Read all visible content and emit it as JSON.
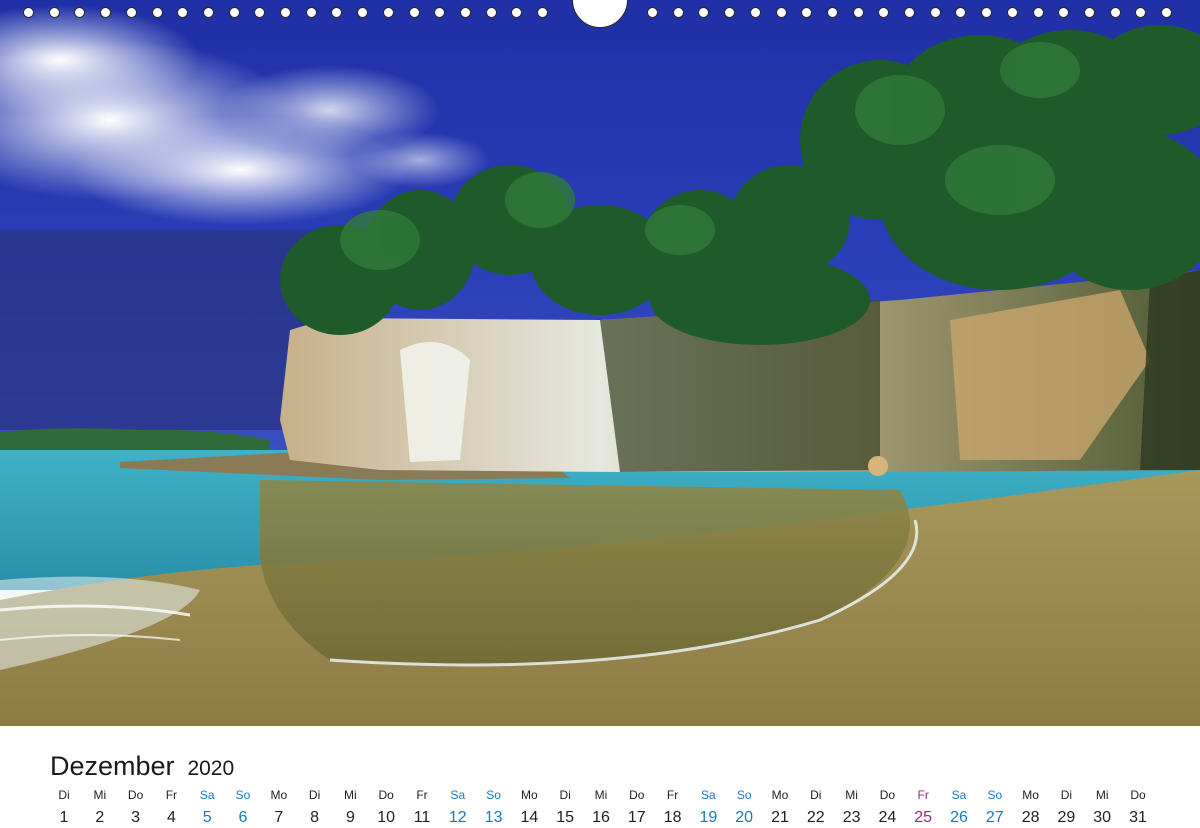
{
  "calendar": {
    "month": "Dezember",
    "year": "2020",
    "weekend_color": "#1a78c2",
    "holiday_color": "#8e2a86",
    "days": [
      {
        "wd": "Di",
        "n": "1",
        "kind": "normal"
      },
      {
        "wd": "Mi",
        "n": "2",
        "kind": "normal"
      },
      {
        "wd": "Do",
        "n": "3",
        "kind": "normal"
      },
      {
        "wd": "Fr",
        "n": "4",
        "kind": "normal"
      },
      {
        "wd": "Sa",
        "n": "5",
        "kind": "weekend"
      },
      {
        "wd": "So",
        "n": "6",
        "kind": "weekend"
      },
      {
        "wd": "Mo",
        "n": "7",
        "kind": "normal"
      },
      {
        "wd": "Di",
        "n": "8",
        "kind": "normal"
      },
      {
        "wd": "Mi",
        "n": "9",
        "kind": "normal"
      },
      {
        "wd": "Do",
        "n": "10",
        "kind": "normal"
      },
      {
        "wd": "Fr",
        "n": "11",
        "kind": "normal"
      },
      {
        "wd": "Sa",
        "n": "12",
        "kind": "weekend"
      },
      {
        "wd": "So",
        "n": "13",
        "kind": "weekend"
      },
      {
        "wd": "Mo",
        "n": "14",
        "kind": "normal"
      },
      {
        "wd": "Di",
        "n": "15",
        "kind": "normal"
      },
      {
        "wd": "Mi",
        "n": "16",
        "kind": "normal"
      },
      {
        "wd": "Do",
        "n": "17",
        "kind": "normal"
      },
      {
        "wd": "Fr",
        "n": "18",
        "kind": "normal"
      },
      {
        "wd": "Sa",
        "n": "19",
        "kind": "weekend"
      },
      {
        "wd": "So",
        "n": "20",
        "kind": "weekend"
      },
      {
        "wd": "Mo",
        "n": "21",
        "kind": "normal"
      },
      {
        "wd": "Di",
        "n": "22",
        "kind": "normal"
      },
      {
        "wd": "Mi",
        "n": "23",
        "kind": "normal"
      },
      {
        "wd": "Do",
        "n": "24",
        "kind": "normal"
      },
      {
        "wd": "Fr",
        "n": "25",
        "kind": "holiday"
      },
      {
        "wd": "Sa",
        "n": "26",
        "kind": "weekend"
      },
      {
        "wd": "So",
        "n": "27",
        "kind": "weekend"
      },
      {
        "wd": "Mo",
        "n": "28",
        "kind": "normal"
      },
      {
        "wd": "Di",
        "n": "29",
        "kind": "normal"
      },
      {
        "wd": "Mi",
        "n": "30",
        "kind": "normal"
      },
      {
        "wd": "Do",
        "n": "31",
        "kind": "normal"
      }
    ]
  }
}
